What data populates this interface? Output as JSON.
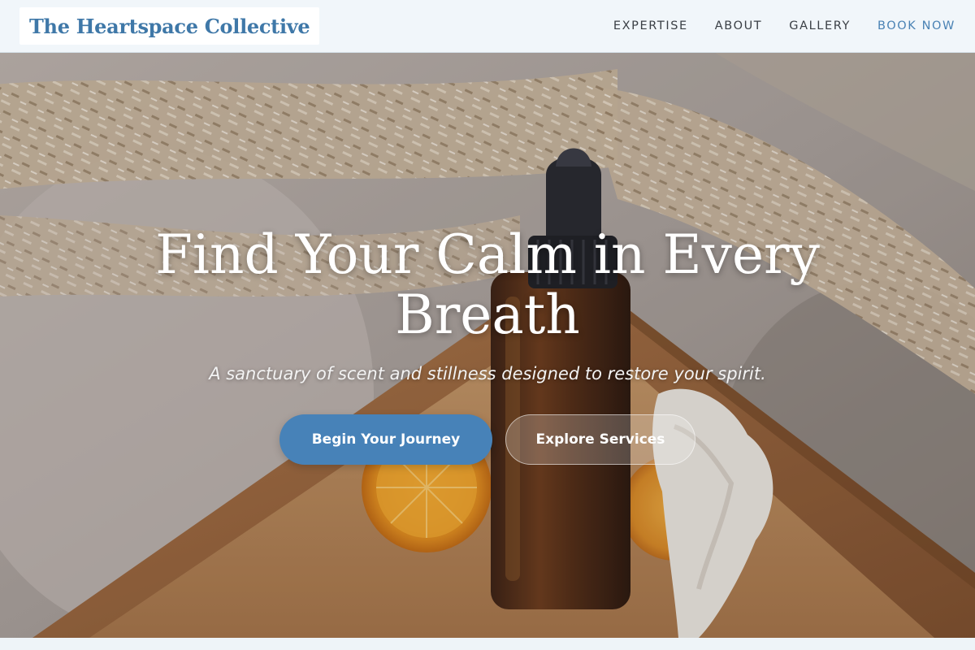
{
  "header": {
    "logo": "The Heartspace Collective",
    "nav": [
      {
        "label": "EXPERTISE"
      },
      {
        "label": "ABOUT"
      },
      {
        "label": "GALLERY"
      },
      {
        "label": "BOOK NOW"
      }
    ]
  },
  "hero": {
    "title": "Find Your Calm in Every Breath",
    "subtitle": "A sanctuary of scent and stillness designed to restore your spirit.",
    "primary_button": "Begin Your Journey",
    "secondary_button": "Explore Services",
    "background_icon": "essential-oil-bottle-photo"
  },
  "colors": {
    "accent": "#4782b8",
    "logo_text": "#3f78a8",
    "header_bg": "#f1f6fa"
  }
}
